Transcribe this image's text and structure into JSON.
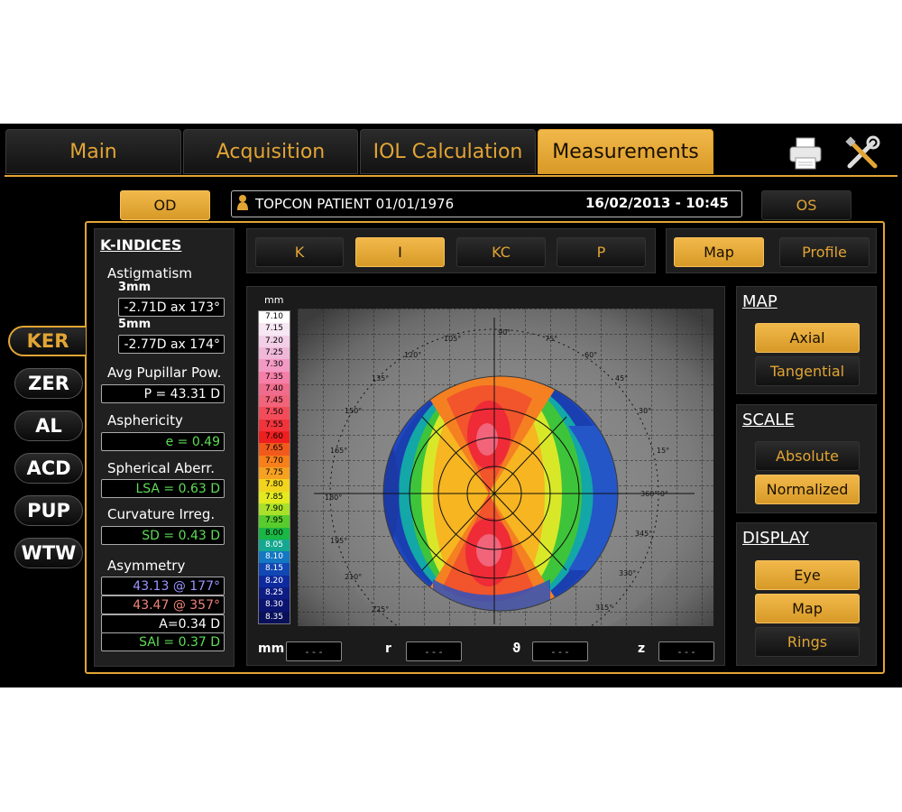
{
  "tabs": {
    "main": "Main",
    "acquisition": "Acquisition",
    "iol": "IOL Calculation",
    "measurements": "Measurements"
  },
  "icons": {
    "print": "printer-icon",
    "tools": "tools-icon",
    "patient": "person-icon"
  },
  "eye_buttons": {
    "od": "OD",
    "os": "OS"
  },
  "patient": {
    "name": "TOPCON PATIENT 01/01/1976",
    "datetime": "16/02/2013 - 10:45"
  },
  "side_tabs": [
    "KER",
    "ZER",
    "AL",
    "ACD",
    "PUP",
    "WTW"
  ],
  "k_indices": {
    "title": "K-INDICES",
    "astigmatism_label": "Astigmatism",
    "mm3_label": "3mm",
    "mm3_value": "-2.71D ax 173°",
    "mm5_label": "5mm",
    "mm5_value": "-2.77D ax 174°",
    "avg_pupillar_label": "Avg Pupillar Pow.",
    "avg_pupillar_value": "P = 43.31 D",
    "asphericity_label": "Asphericity",
    "asphericity_value": "e = 0.49",
    "spherical_label": "Spherical Aberr.",
    "spherical_value": "LSA = 0.63 D",
    "curvature_label": "Curvature Irreg.",
    "curvature_value": "SD = 0.43 D",
    "asymmetry_label": "Asymmetry",
    "asym_1": "43.13  @ 177°",
    "asym_2": "43.47  @ 357°",
    "asym_3": "A=0.34 D",
    "asym_4": "SAI = 0.37 D"
  },
  "map_type_buttons": [
    "K",
    "I",
    "KC",
    "P"
  ],
  "view_buttons": {
    "map": "Map",
    "profile": "Profile"
  },
  "map_panel": {
    "scale_unit": "mm",
    "scale_values": [
      "7.10",
      "7.15",
      "7.20",
      "7.25",
      "7.30",
      "7.35",
      "7.40",
      "7.45",
      "7.50",
      "7.55",
      "7.60",
      "7.65",
      "7.70",
      "7.75",
      "7.80",
      "7.85",
      "7.90",
      "7.95",
      "8.00",
      "8.05",
      "8.10",
      "8.15",
      "8.20",
      "8.25",
      "8.30",
      "8.35"
    ],
    "scale_colors": [
      "#ffffff",
      "#f7e6f3",
      "#f2cfe6",
      "#efb8d9",
      "#f39ac4",
      "#f57fa8",
      "#ef6c8c",
      "#f1647a",
      "#f24c5a",
      "#f1343c",
      "#ef1f1f",
      "#f25a1b",
      "#f7801b",
      "#f6a121",
      "#f2d41e",
      "#e3ea1f",
      "#a9e12a",
      "#58cc2c",
      "#19b844",
      "#14a890",
      "#1377c3",
      "#1248b4",
      "#0f2a9e",
      "#0d1d84",
      "#0b1470",
      "#08105a"
    ],
    "angle_labels": [
      "90°",
      "75°",
      "60°",
      "45°",
      "30°",
      "15°",
      "360° 0°",
      "345°",
      "330°",
      "315°",
      "105°",
      "120°",
      "135°",
      "150°",
      "165°",
      "180°",
      "195°",
      "210°",
      "225°"
    ],
    "coords": [
      {
        "label": "mm",
        "value": "- - -"
      },
      {
        "label": "r",
        "value": "- - -"
      },
      {
        "label": "ϑ",
        "value": "- - -"
      },
      {
        "label": "z",
        "value": "- - -"
      }
    ]
  },
  "map_section": {
    "title": "MAP",
    "axial": "Axial",
    "tangential": "Tangential"
  },
  "scale_section": {
    "title": "SCALE",
    "absolute": "Absolute",
    "normalized": "Normalized"
  },
  "display_section": {
    "title": "DISPLAY",
    "eye": "Eye",
    "map": "Map",
    "rings": "Rings"
  }
}
